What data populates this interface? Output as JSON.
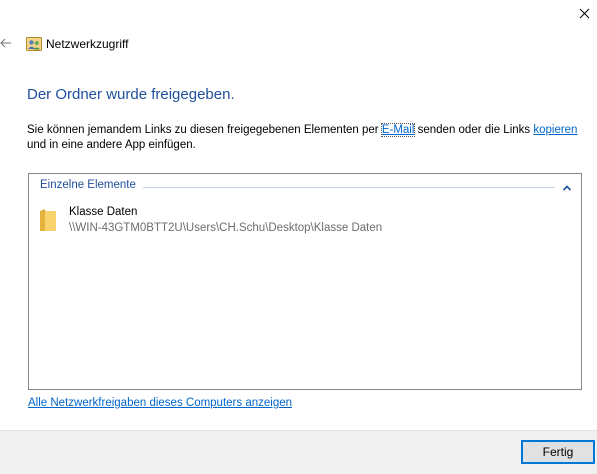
{
  "window": {
    "title": "Netzwerkzugriff",
    "close_icon": "close-icon",
    "back_icon": "back-arrow-icon",
    "title_icon": "network-users-icon"
  },
  "main": {
    "heading": "Der Ordner wurde freigegeben.",
    "description": {
      "part1": "Sie können jemandem Links zu diesen freigegebenen Elementen per ",
      "email_link": "E-Mail",
      "part2": " senden oder die Links ",
      "copy_link": "kopieren",
      "part3": " und in eine andere App einfügen."
    },
    "group": {
      "label": "Einzelne Elemente",
      "collapse_icon": "chevron-up-icon",
      "items": [
        {
          "name": "Klasse Daten",
          "path": "\\\\WIN-43GTM0BTT2U\\Users\\CH.Schu\\Desktop\\Klasse Daten",
          "icon": "folder-icon"
        }
      ]
    },
    "show_all_link": "Alle Netzwerkfreigaben dieses Computers anzeigen"
  },
  "footer": {
    "finish_button": "Fertig"
  },
  "colors": {
    "heading": "#1e4e9c",
    "link": "#0066cc",
    "accent": "#0078d7",
    "footer_bg": "#f0f0f0"
  }
}
